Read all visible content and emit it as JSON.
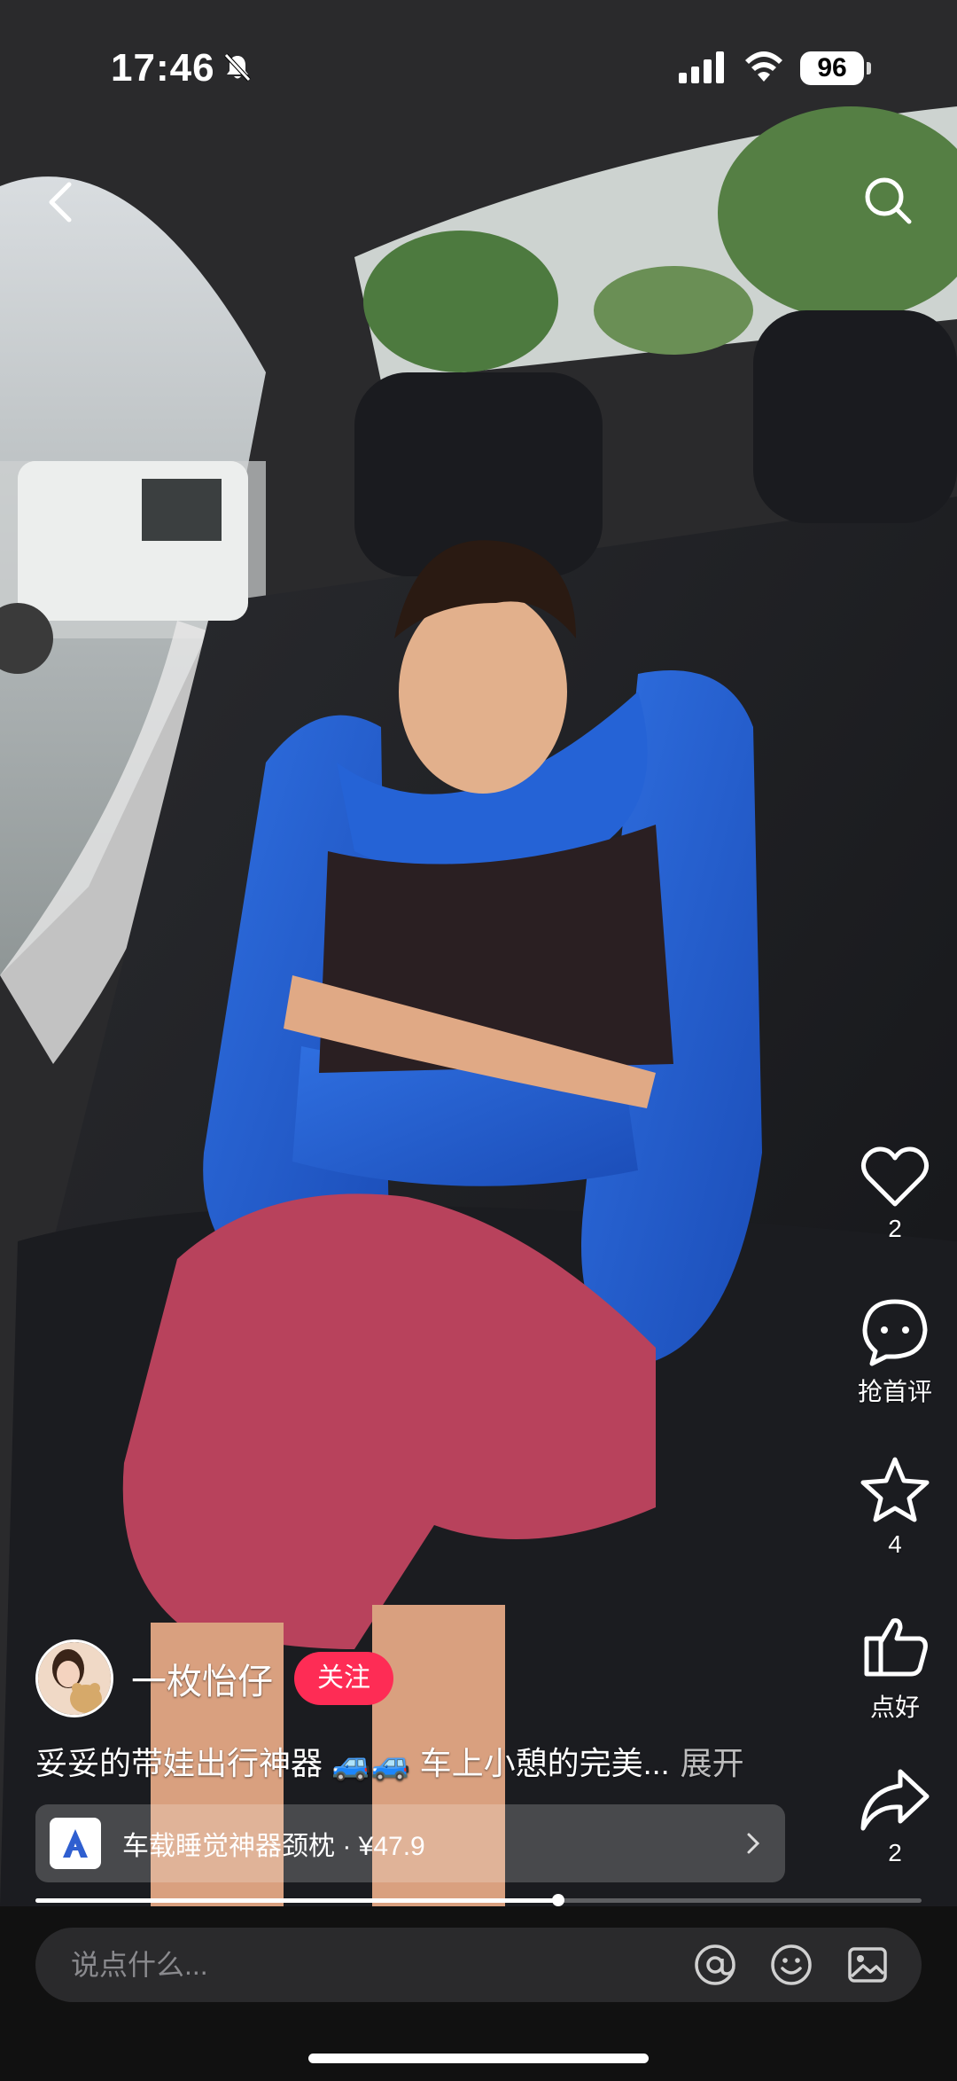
{
  "status_bar": {
    "time": "17:46",
    "battery": "96"
  },
  "actions": {
    "like": {
      "icon": "heart-icon",
      "count": "2"
    },
    "comment": {
      "icon": "comment-icon",
      "label": "抢首评"
    },
    "favorite": {
      "icon": "star-icon",
      "count": "4"
    },
    "good": {
      "icon": "thumbs-up-icon",
      "label": "点好"
    },
    "share": {
      "icon": "share-icon",
      "count": "2"
    }
  },
  "author": {
    "name": "一枚怡仔",
    "follow_label": "关注"
  },
  "caption": {
    "text": "妥妥的带娃出行神器 🚙🚙 车上小憩的完美...",
    "more": "展开"
  },
  "product": {
    "title": "车载睡觉神器颈枕 · ¥47.9"
  },
  "playback": {
    "progress": 0.59
  },
  "comment_bar": {
    "placeholder": "说点什么..."
  },
  "colors": {
    "accent": "#fe2c55"
  }
}
